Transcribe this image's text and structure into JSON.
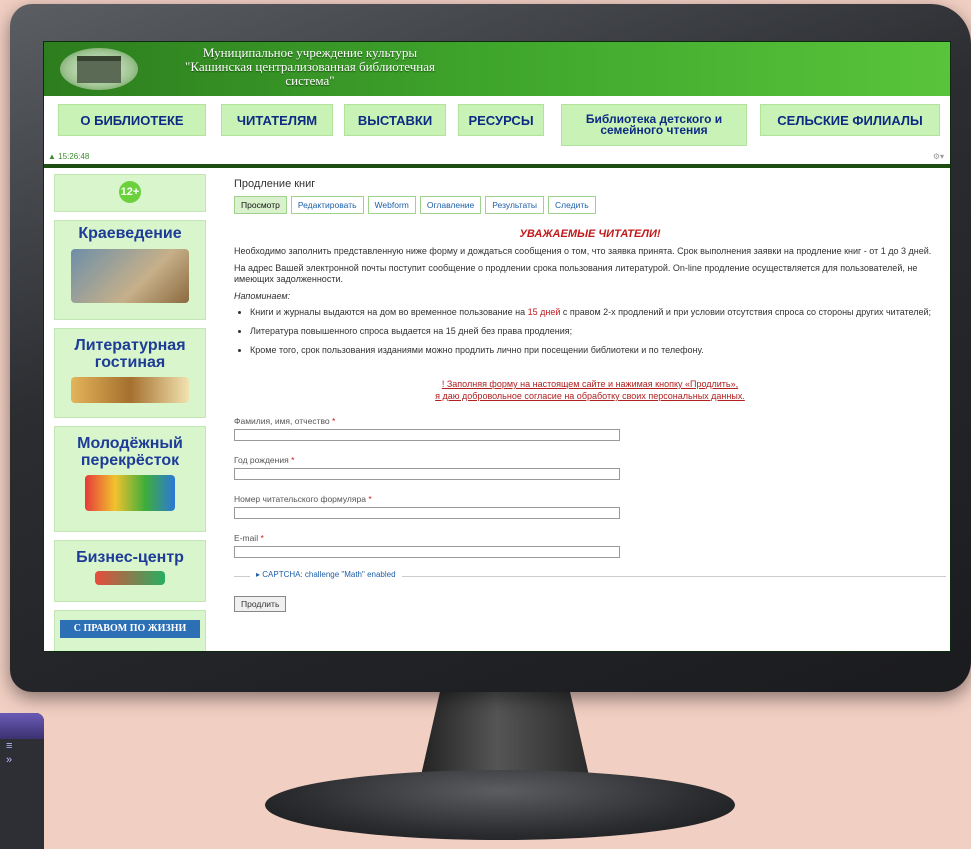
{
  "header": {
    "org_line1": "Муниципальное учреждение культуры",
    "org_line2": "\"Кашинская централизованная библиотечная",
    "org_line3": "система\""
  },
  "nav": {
    "items": [
      {
        "label": "О БИБЛИОТЕКЕ"
      },
      {
        "label": "ЧИТАТЕЛЯМ"
      },
      {
        "label": "ВЫСТАВКИ"
      },
      {
        "label": "РЕСУРСЫ"
      },
      {
        "label": "Библиотека детского и семейного чтения"
      },
      {
        "label": "СЕЛЬСКИЕ ФИЛИАЛЫ"
      }
    ]
  },
  "status": {
    "time": "15:26:48",
    "gear_icon": "gear-icon"
  },
  "sidebar": {
    "age_badge": "12+",
    "blocks": [
      {
        "label": "Краеведение"
      },
      {
        "label": "Литературная гостиная"
      },
      {
        "label": "Молодёжный перекрёсток"
      },
      {
        "label": "Бизнес-центр"
      },
      {
        "label": "С ПРАВОМ ПО ЖИЗНИ"
      }
    ]
  },
  "content": {
    "page_title": "Продление книг",
    "tabs": [
      {
        "label": "Просмотр",
        "active": true
      },
      {
        "label": "Редактировать"
      },
      {
        "label": "Webform"
      },
      {
        "label": "Оглавление"
      },
      {
        "label": "Результаты"
      },
      {
        "label": "Следить"
      }
    ],
    "heading": "УВАЖАЕМЫЕ ЧИТАТЕЛИ!",
    "para1": "Необходимо заполнить представленную ниже форму и дождаться сообщения о том, что заявка принята. Срок выполнения заявки на продление книг - от 1 до 3 дней.",
    "para2": "На адрес Вашей электронной почты поступит сообщение о продлении срока пользования литературой. On-line продление осуществляется для пользователей, не имеющих задолженности.",
    "reminder": "Напоминаем:",
    "bullet1_a": "Книги и журналы выдаются на дом во временное пользование на ",
    "bullet1_red": "15 дней",
    "bullet1_b": " с правом 2-х продлений и при условии отсутствия спроса со стороны других читателей;",
    "bullet2": "Литература повышенного спроса выдается на 15 дней без права продления;",
    "bullet3": "Кроме того, срок пользования изданиями можно продлить лично при посещении библиотеки и по телефону.",
    "consent_line1": "! Заполняя форму на настоящем сайте и нажимая кнопку «Продлить»,",
    "consent_line2": "я даю добровольное согласие на обработку своих персональных данных."
  },
  "form": {
    "fields": [
      {
        "label": "Фамилия, имя, отчество",
        "value": ""
      },
      {
        "label": "Год рождения",
        "value": ""
      },
      {
        "label": "Номер читательского формуляра",
        "value": ""
      },
      {
        "label": "E-mail",
        "value": ""
      }
    ],
    "required_mark": "*",
    "captcha": "▸ CAPTCHA: challenge \"Math\" enabled",
    "submit_label": "Продлить"
  },
  "side_window": {
    "icon1": "≡",
    "icon2": "»"
  }
}
